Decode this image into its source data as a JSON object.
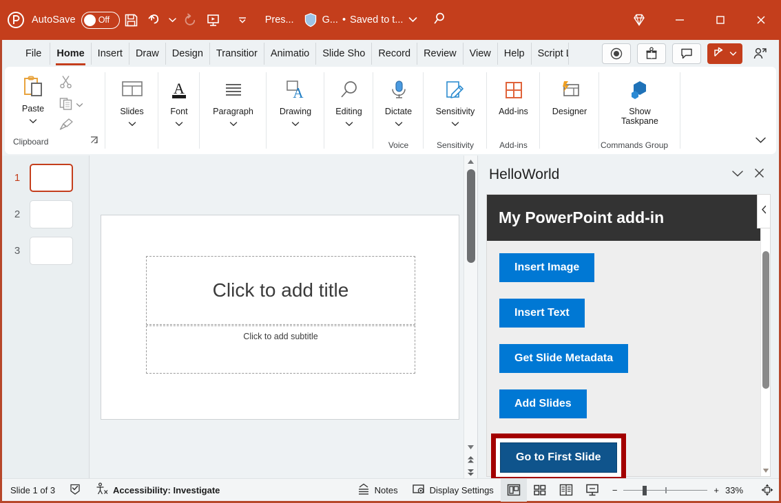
{
  "titlebar": {
    "app_icon": "powerpoint-logo-icon",
    "autosave_label": "AutoSave",
    "autosave_state": "Off",
    "save_icon": "save-icon",
    "undo_icon": "undo-icon",
    "undo_chevron": "chevron-down-icon",
    "redo_icon": "redo-icon",
    "present_icon": "start-presentation-icon",
    "customize_icon": "customize-quick-access-icon",
    "file_name": "Pres...",
    "shield_icon": "shield-icon",
    "user_label": "G...",
    "separator_dot": "•",
    "saved_label": "Saved to t...",
    "saved_chevron": "chevron-down-icon",
    "search_icon": "search-icon",
    "diamond_icon": "diamond-icon",
    "minimize_icon": "minimize-icon",
    "maximize_icon": "maximize-icon",
    "close_icon": "close-icon"
  },
  "tabs": [
    {
      "label": "File",
      "active": false
    },
    {
      "label": "Home",
      "active": true
    },
    {
      "label": "Insert",
      "active": false
    },
    {
      "label": "Draw",
      "active": false
    },
    {
      "label": "Design",
      "active": false
    },
    {
      "label": "Transitior",
      "active": false
    },
    {
      "label": "Animatio",
      "active": false
    },
    {
      "label": "Slide Sho",
      "active": false
    },
    {
      "label": "Record",
      "active": false
    },
    {
      "label": "Review",
      "active": false
    },
    {
      "label": "View",
      "active": false
    },
    {
      "label": "Help",
      "active": false
    },
    {
      "label": "Script Lab",
      "active": false
    }
  ],
  "tabs_right": {
    "record_button": "record-icon",
    "teams_button": "teams-gift-icon",
    "comments_button": "comment-icon",
    "share_label": "",
    "share_icon": "share-icon",
    "share_chevron": "chevron-down-icon",
    "person_icon": "person-add-icon"
  },
  "ribbon": {
    "clipboard": {
      "paste_label": "Paste",
      "paste_chevron": "chevron-down-icon",
      "cut_icon": "scissors-icon",
      "copy_icon": "copy-icon",
      "copy_chevron": "chevron-down-icon",
      "format_painter_icon": "format-painter-icon",
      "group_label": "Clipboard",
      "dialog_launcher_icon": "dialog-launcher-icon"
    },
    "groups": [
      {
        "label": "Slides",
        "icon": "slides-layout-icon",
        "chevron": "chevron-down-icon",
        "group_label": ""
      },
      {
        "label": "Font",
        "icon": "font-icon",
        "chevron": "chevron-down-icon",
        "group_label": ""
      },
      {
        "label": "Paragraph",
        "icon": "paragraph-icon",
        "chevron": "chevron-down-icon",
        "group_label": ""
      },
      {
        "label": "Drawing",
        "icon": "drawing-icon",
        "chevron": "chevron-down-icon",
        "group_label": ""
      },
      {
        "label": "Editing",
        "icon": "magnifier-icon",
        "chevron": "chevron-down-icon",
        "group_label": ""
      },
      {
        "label": "Dictate",
        "icon": "microphone-icon",
        "chevron": "chevron-down-icon",
        "group_label": "Voice"
      },
      {
        "label": "Sensitivity",
        "icon": "sensitivity-icon",
        "chevron": "chevron-down-icon",
        "group_label": "Sensitivity"
      },
      {
        "label": "Add-ins",
        "icon": "addins-grid-icon",
        "chevron": "",
        "group_label": "Add-ins"
      },
      {
        "label": "Designer",
        "icon": "designer-icon",
        "chevron": "",
        "group_label": ""
      },
      {
        "label": "Show\nTaskpane",
        "icon": "taskpane-cube-icon",
        "chevron": "",
        "group_label": "Commands Group"
      }
    ],
    "collapse_ribbon_icon": "chevron-down-icon"
  },
  "thumbnails": [
    {
      "number": "1",
      "selected": true
    },
    {
      "number": "2",
      "selected": false
    },
    {
      "number": "3",
      "selected": false
    }
  ],
  "slide": {
    "title_placeholder": "Click to add title",
    "subtitle_placeholder": "Click to add subtitle",
    "scroll_up_icon": "scroll-up-icon",
    "scroll_down_icon": "scroll-down-icon",
    "prev_slide_icon": "previous-slide-icon",
    "next_slide_icon": "next-slide-icon"
  },
  "taskpane": {
    "title": "HelloWorld",
    "chevron_icon": "chevron-down-icon",
    "close_icon": "close-icon",
    "collapse_icon": "chevron-left-icon",
    "addin_heading": "My PowerPoint add-in",
    "buttons": [
      {
        "label": "Insert Image",
        "pressed": false
      },
      {
        "label": "Insert Text",
        "pressed": false
      },
      {
        "label": "Get Slide Metadata",
        "pressed": false
      },
      {
        "label": "Add Slides",
        "pressed": false
      },
      {
        "label": "Go to First Slide",
        "pressed": true
      }
    ],
    "scroll_down_icon": "scroll-down-icon"
  },
  "statusbar": {
    "slide_indicator": "Slide 1 of 3",
    "spellcheck_icon": "spellcheck-icon",
    "accessibility_icon": "accessibility-icon",
    "accessibility_label": "Accessibility: Investigate",
    "notes_icon": "notes-icon",
    "notes_label": "Notes",
    "display_settings_icon": "display-settings-icon",
    "display_settings_label": "Display Settings",
    "views": [
      {
        "name": "normal-view",
        "active": true
      },
      {
        "name": "slide-sorter-view",
        "active": false
      },
      {
        "name": "reading-view",
        "active": false
      },
      {
        "name": "slideshow-view",
        "active": false
      }
    ],
    "zoom_out_label": "−",
    "zoom_in_label": "+",
    "zoom_percent": "33%",
    "fit_slide_icon": "fit-to-window-icon"
  },
  "colors": {
    "brand": "#c43e1c",
    "accent_blue": "#0078d4",
    "pressed_blue": "#0f548c",
    "highlight_red": "#a30000",
    "addin_header": "#333333"
  }
}
